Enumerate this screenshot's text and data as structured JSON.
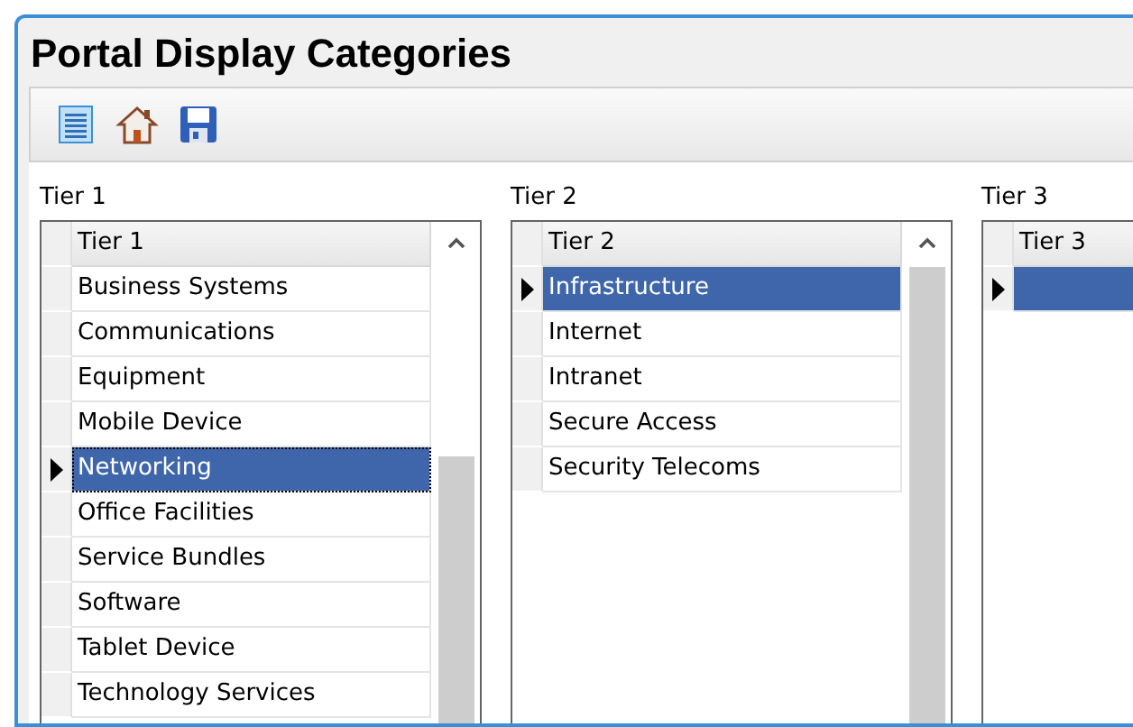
{
  "window": {
    "title": "Portal Display Categories"
  },
  "toolbar": {
    "buttons": [
      {
        "kind": "list"
      },
      {
        "kind": "home"
      },
      {
        "kind": "save"
      }
    ]
  },
  "grids": [
    {
      "label": "Tier 1",
      "column": "Tier 1",
      "scrollbar": true,
      "rows": [
        {
          "text": "Business Systems",
          "selected": false,
          "focused": false
        },
        {
          "text": "Communications",
          "selected": false,
          "focused": false
        },
        {
          "text": "Equipment",
          "selected": false,
          "focused": false
        },
        {
          "text": "Mobile Device",
          "selected": false,
          "focused": false
        },
        {
          "text": "Networking",
          "selected": true,
          "focused": true
        },
        {
          "text": "Office Facilities",
          "selected": false,
          "focused": false
        },
        {
          "text": "Service Bundles",
          "selected": false,
          "focused": false
        },
        {
          "text": "Software",
          "selected": false,
          "focused": false
        },
        {
          "text": "Tablet Device",
          "selected": false,
          "focused": false
        },
        {
          "text": "Technology Services",
          "selected": false,
          "focused": false
        }
      ]
    },
    {
      "label": "Tier 2",
      "column": "Tier 2",
      "scrollbar": true,
      "rows": [
        {
          "text": "Infrastructure",
          "selected": true,
          "focused": false
        },
        {
          "text": "Internet",
          "selected": false,
          "focused": false
        },
        {
          "text": "Intranet",
          "selected": false,
          "focused": false
        },
        {
          "text": "Secure Access",
          "selected": false,
          "focused": false
        },
        {
          "text": "Security Telecoms",
          "selected": false,
          "focused": false
        }
      ]
    },
    {
      "label": "Tier 3",
      "column": "Tier 3",
      "scrollbar": false,
      "rows": [
        {
          "selected": true,
          "focused": false
        }
      ]
    }
  ]
}
